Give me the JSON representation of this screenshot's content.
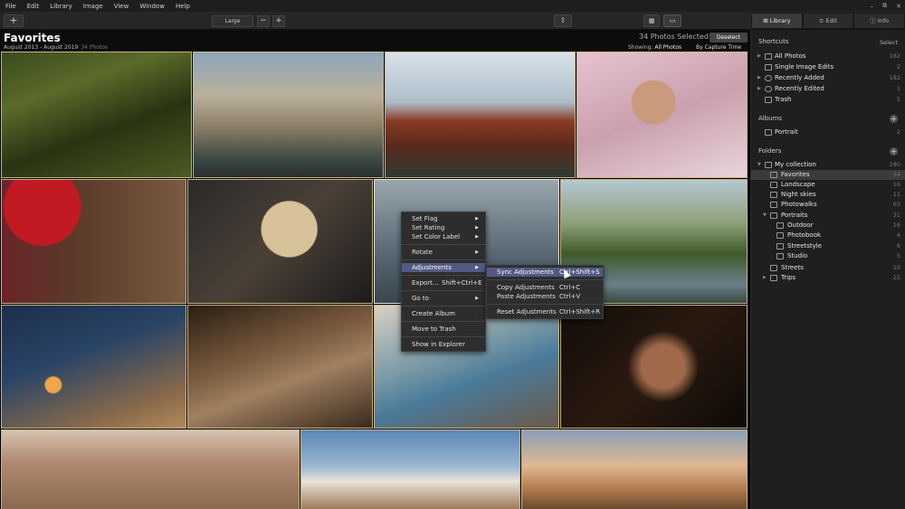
{
  "menubar": [
    "File",
    "Edit",
    "Library",
    "Image",
    "View",
    "Window",
    "Help"
  ],
  "window_controls": [
    "–",
    "⧉",
    "✕"
  ],
  "toolbar": {
    "add_label": "+",
    "size_value": "Large",
    "zoom_out": "−",
    "zoom_in": "+",
    "share_icon": "⇪",
    "grid_icon": "▦",
    "single_icon": "▭"
  },
  "tabs": [
    {
      "icon": "⊞",
      "label": "Library"
    },
    {
      "icon": "≡",
      "label": "Edit"
    },
    {
      "icon": "ⓘ",
      "label": "Info"
    }
  ],
  "header": {
    "title": "Favorites",
    "dates": "August 2013 - August 2019",
    "count": "34 Photos",
    "selected": "34 Photos Selected",
    "deselect": "Deselect",
    "showing_label": "Showing:",
    "showing_value": "All Photos",
    "sort": "By Capture Time"
  },
  "context_menu": {
    "items": [
      {
        "label": "Set Flag",
        "arrow": "▶"
      },
      {
        "label": "Set Rating",
        "arrow": "▶"
      },
      {
        "label": "Set Color Label",
        "arrow": "▶"
      },
      {
        "label": "Rotate",
        "arrow": "▶"
      },
      {
        "label": "Adjustments",
        "arrow": "▶"
      },
      {
        "label": "Export...",
        "shortcut": "Shift+Ctrl+E"
      },
      {
        "label": "Go to",
        "arrow": "▶"
      },
      {
        "label": "Create Album"
      },
      {
        "label": "Move to Trash"
      },
      {
        "label": "Show in Explorer"
      }
    ]
  },
  "submenu": {
    "items": [
      {
        "label": "Sync Adjustments",
        "shortcut": "Ctrl+Shift+S"
      },
      {
        "label": "Copy Adjustments",
        "shortcut": "Ctrl+C"
      },
      {
        "label": "Paste Adjustments",
        "shortcut": "Ctrl+V"
      },
      {
        "label": "Reset Adjustments",
        "shortcut": "Ctrl+Shift+R"
      }
    ]
  },
  "sidebar": {
    "shortcuts_title": "Shortcuts",
    "shortcuts_action": "Select",
    "shortcuts": [
      {
        "label": "All Photos",
        "count": "182"
      },
      {
        "label": "Single Image Edits",
        "count": "2"
      },
      {
        "label": "Recently Added",
        "count": "182"
      },
      {
        "label": "Recently Edited",
        "count": "1"
      },
      {
        "label": "Trash",
        "count": "5"
      }
    ],
    "albums_title": "Albums",
    "albums": [
      {
        "label": "Portrait",
        "count": "2"
      }
    ],
    "folders_title": "Folders",
    "folders": [
      {
        "label": "My collection",
        "count": "180"
      },
      {
        "label": "Favorites",
        "count": "34"
      },
      {
        "label": "Landscape",
        "count": "16"
      },
      {
        "label": "Night skies",
        "count": "11"
      },
      {
        "label": "Photowalks",
        "count": "63"
      },
      {
        "label": "Portraits",
        "count": "31"
      },
      {
        "label": "Outdoor",
        "count": "16"
      },
      {
        "label": "Photobook",
        "count": "4"
      },
      {
        "label": "Streetstyle",
        "count": "6"
      },
      {
        "label": "Studio",
        "count": "5"
      },
      {
        "label": "Streets",
        "count": "10"
      },
      {
        "label": "Trips",
        "count": "25"
      }
    ]
  },
  "photo_names": [
    "mossy-forest",
    "trevi-fountain",
    "lake-temple",
    "cherry-blossom-portrait",
    "red-umbrella-kimono",
    "blonde-portrait",
    "coastal-city",
    "japanese-garden-pavilion",
    "desert-lantern-room",
    "man-driving-car",
    "cyclists-street",
    "dark-portrait",
    "canyon-cliff",
    "desert-car-sky",
    "riverside-temple"
  ]
}
